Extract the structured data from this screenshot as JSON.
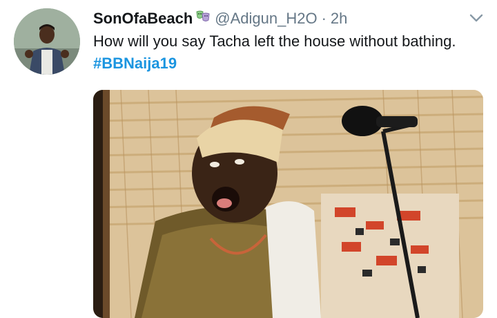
{
  "tweet": {
    "display_name": "SonOfaBeach",
    "badge_icon": "theater-masks-icon",
    "handle": "@Adigun_H2O",
    "separator": "·",
    "time": "2h",
    "text_main": "How will you say Tacha left the  house without bathing.",
    "hashtag": "#BBNaija19",
    "menu_icon": "chevron-down-icon",
    "colors": {
      "link": "#1b95e0",
      "meta": "#657786",
      "text": "#14171a"
    }
  }
}
